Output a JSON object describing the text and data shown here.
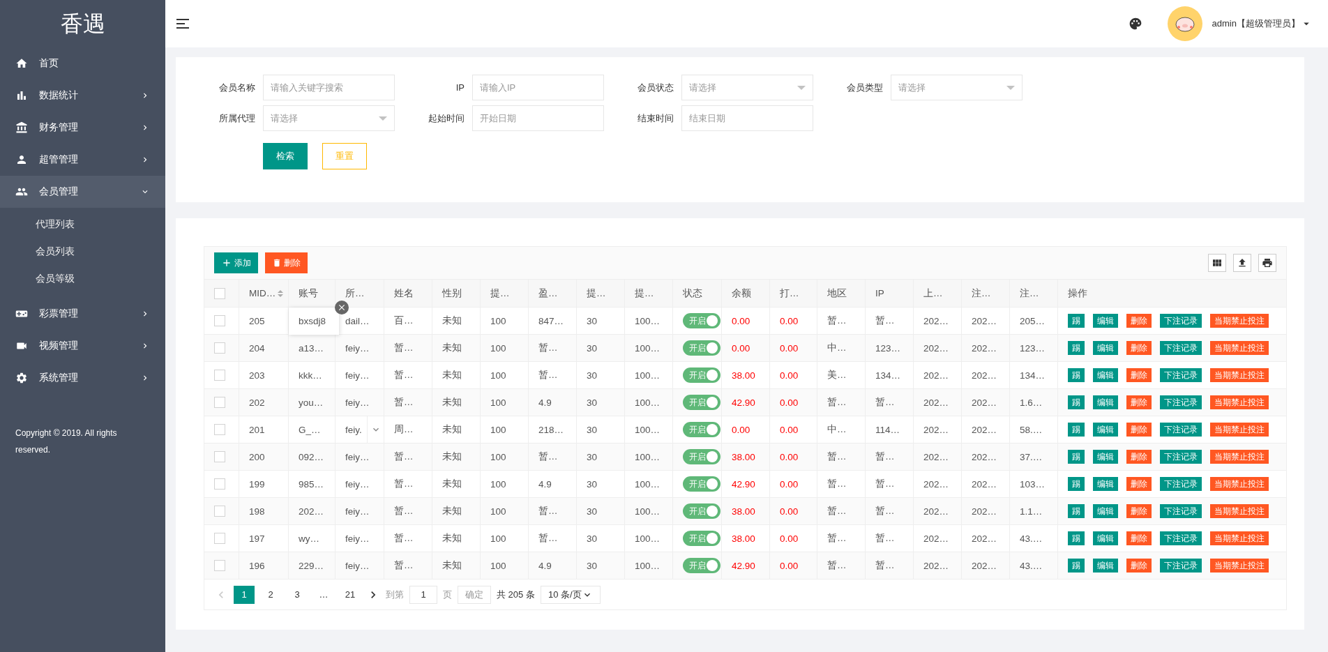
{
  "sidebar": {
    "logo": "香遇",
    "items": [
      {
        "label": "首页",
        "has_arrow": false,
        "expanded": false
      },
      {
        "label": "数据统计",
        "has_arrow": true,
        "expanded": false
      },
      {
        "label": "财务管理",
        "has_arrow": true,
        "expanded": false
      },
      {
        "label": "超管管理",
        "has_arrow": true,
        "expanded": false
      },
      {
        "label": "会员管理",
        "has_arrow": true,
        "expanded": true,
        "children": [
          {
            "label": "代理列表"
          },
          {
            "label": "会员列表"
          },
          {
            "label": "会员等级"
          }
        ]
      },
      {
        "label": "彩票管理",
        "has_arrow": true,
        "expanded": false
      },
      {
        "label": "视频管理",
        "has_arrow": true,
        "expanded": false
      },
      {
        "label": "系统管理",
        "has_arrow": true,
        "expanded": false
      }
    ],
    "copyright": "Copyright © 2019. All rights reserved."
  },
  "header": {
    "user": "admin【超级管理员】"
  },
  "filters": {
    "fields": [
      {
        "label": "会员名称",
        "kind": "input",
        "placeholder": "请输入关键字搜索"
      },
      {
        "label": "IP",
        "kind": "input",
        "placeholder": "请输入IP"
      },
      {
        "label": "会员状态",
        "kind": "select",
        "placeholder": "请选择"
      },
      {
        "label": "会员类型",
        "kind": "select",
        "placeholder": "请选择"
      },
      {
        "label": "所属代理",
        "kind": "select",
        "placeholder": "请选择"
      },
      {
        "label": "起始时间",
        "kind": "input",
        "placeholder": "开始日期"
      },
      {
        "label": "结束时间",
        "kind": "input",
        "placeholder": "结束日期"
      }
    ],
    "buttons": [
      {
        "label": "检索",
        "kind": "primary"
      },
      {
        "label": "重置",
        "kind": "outline"
      }
    ]
  },
  "toolbar": {
    "buttons": [
      {
        "label": "添加",
        "kind": "add"
      },
      {
        "label": "删除",
        "kind": "delete"
      }
    ]
  },
  "table": {
    "all_checked": false,
    "columns": [
      {
        "label": "MID…",
        "kind": "text",
        "sortable": true
      },
      {
        "label": "账号",
        "kind": "text",
        "sortable": false
      },
      {
        "label": "所…",
        "kind": "text",
        "sortable": false
      },
      {
        "label": "姓名",
        "kind": "text",
        "sortable": false
      },
      {
        "label": "性别",
        "kind": "text",
        "sortable": false
      },
      {
        "label": "提…",
        "kind": "text",
        "sortable": false
      },
      {
        "label": "盈…",
        "kind": "text",
        "sortable": false
      },
      {
        "label": "提…",
        "kind": "text",
        "sortable": false
      },
      {
        "label": "提…",
        "kind": "text",
        "sortable": false
      },
      {
        "label": "状态",
        "kind": "switch"
      },
      {
        "label": "余额",
        "kind": "money"
      },
      {
        "label": "打…",
        "kind": "money"
      },
      {
        "label": "地区",
        "kind": "text",
        "sortable": false
      },
      {
        "label": "IP",
        "kind": "text",
        "sortable": false
      },
      {
        "label": "上…",
        "kind": "text",
        "sortable": false
      },
      {
        "label": "注…",
        "kind": "text",
        "sortable": false
      },
      {
        "label": "注…",
        "kind": "text",
        "sortable": false
      },
      {
        "label": "操作",
        "kind": "actions"
      }
    ],
    "rows": [
      {
        "checked": false,
        "expanded": true,
        "dropdown": false,
        "status_on": true,
        "cells": [
          "205",
          "bxsdj8",
          "dail…",
          "百…",
          "未知",
          "100",
          "847…",
          "30",
          "100…",
          "开启",
          "0.00",
          "0.00",
          "暂…",
          "暂…",
          "202…",
          "202…",
          "205…"
        ],
        "actions": [
          {
            "label": "踢",
            "kind": "primary"
          },
          {
            "label": "编辑",
            "kind": "primary"
          },
          {
            "label": "删除",
            "kind": "danger"
          },
          {
            "label": "下注记录",
            "kind": "primary"
          },
          {
            "label": "当期禁止投注",
            "kind": "danger"
          }
        ]
      },
      {
        "checked": false,
        "expanded": false,
        "dropdown": false,
        "status_on": true,
        "cells": [
          "204",
          "a13…",
          "feiy…",
          "暂…",
          "未知",
          "100",
          "暂…",
          "30",
          "100…",
          "开启",
          "0.00",
          "0.00",
          "中…",
          "123…",
          "202…",
          "202…",
          "123…"
        ],
        "actions": [
          {
            "label": "踢",
            "kind": "primary"
          },
          {
            "label": "编辑",
            "kind": "primary"
          },
          {
            "label": "删除",
            "kind": "danger"
          },
          {
            "label": "下注记录",
            "kind": "primary"
          },
          {
            "label": "当期禁止投注",
            "kind": "danger"
          }
        ]
      },
      {
        "checked": false,
        "expanded": false,
        "dropdown": false,
        "status_on": true,
        "cells": [
          "203",
          "kkk…",
          "feiy…",
          "暂…",
          "未知",
          "100",
          "暂…",
          "30",
          "100…",
          "开启",
          "38.00",
          "0.00",
          "美…",
          "134…",
          "202…",
          "202…",
          "134…"
        ],
        "actions": [
          {
            "label": "踢",
            "kind": "primary"
          },
          {
            "label": "编辑",
            "kind": "primary"
          },
          {
            "label": "删除",
            "kind": "danger"
          },
          {
            "label": "下注记录",
            "kind": "primary"
          },
          {
            "label": "当期禁止投注",
            "kind": "danger"
          }
        ]
      },
      {
        "checked": false,
        "expanded": false,
        "dropdown": false,
        "status_on": true,
        "cells": [
          "202",
          "you…",
          "feiy…",
          "暂…",
          "未知",
          "100",
          "4.9",
          "30",
          "100…",
          "开启",
          "42.90",
          "0.00",
          "暂…",
          "暂…",
          "202…",
          "202…",
          "1.6…"
        ],
        "actions": [
          {
            "label": "踢",
            "kind": "primary"
          },
          {
            "label": "编辑",
            "kind": "primary"
          },
          {
            "label": "删除",
            "kind": "danger"
          },
          {
            "label": "下注记录",
            "kind": "primary"
          },
          {
            "label": "当期禁止投注",
            "kind": "danger"
          }
        ]
      },
      {
        "checked": false,
        "expanded": false,
        "dropdown": true,
        "status_on": true,
        "cells": [
          "201",
          "G_…",
          "feiy.",
          "周…",
          "未知",
          "100",
          "218…",
          "30",
          "100…",
          "开启",
          "0.00",
          "0.00",
          "中…",
          "114…",
          "202…",
          "202…",
          "58.…"
        ],
        "actions": [
          {
            "label": "踢",
            "kind": "primary"
          },
          {
            "label": "编辑",
            "kind": "primary"
          },
          {
            "label": "删除",
            "kind": "danger"
          },
          {
            "label": "下注记录",
            "kind": "primary"
          },
          {
            "label": "当期禁止投注",
            "kind": "danger"
          }
        ]
      },
      {
        "checked": false,
        "expanded": false,
        "dropdown": false,
        "status_on": true,
        "cells": [
          "200",
          "092…",
          "feiy…",
          "暂…",
          "未知",
          "100",
          "暂…",
          "30",
          "100…",
          "开启",
          "38.00",
          "0.00",
          "暂…",
          "暂…",
          "202…",
          "202…",
          "37.…"
        ],
        "actions": [
          {
            "label": "踢",
            "kind": "primary"
          },
          {
            "label": "编辑",
            "kind": "primary"
          },
          {
            "label": "删除",
            "kind": "danger"
          },
          {
            "label": "下注记录",
            "kind": "primary"
          },
          {
            "label": "当期禁止投注",
            "kind": "danger"
          }
        ]
      },
      {
        "checked": false,
        "expanded": false,
        "dropdown": false,
        "status_on": true,
        "cells": [
          "199",
          "985…",
          "feiy…",
          "暂…",
          "未知",
          "100",
          "4.9",
          "30",
          "100…",
          "开启",
          "42.90",
          "0.00",
          "暂…",
          "暂…",
          "202…",
          "202…",
          "103…"
        ],
        "actions": [
          {
            "label": "踢",
            "kind": "primary"
          },
          {
            "label": "编辑",
            "kind": "primary"
          },
          {
            "label": "删除",
            "kind": "danger"
          },
          {
            "label": "下注记录",
            "kind": "primary"
          },
          {
            "label": "当期禁止投注",
            "kind": "danger"
          }
        ]
      },
      {
        "checked": false,
        "expanded": false,
        "dropdown": false,
        "status_on": true,
        "cells": [
          "198",
          "202…",
          "feiy…",
          "暂…",
          "未知",
          "100",
          "暂…",
          "30",
          "100…",
          "开启",
          "38.00",
          "0.00",
          "暂…",
          "暂…",
          "202…",
          "202…",
          "1.1…"
        ],
        "actions": [
          {
            "label": "踢",
            "kind": "primary"
          },
          {
            "label": "编辑",
            "kind": "primary"
          },
          {
            "label": "删除",
            "kind": "danger"
          },
          {
            "label": "下注记录",
            "kind": "primary"
          },
          {
            "label": "当期禁止投注",
            "kind": "danger"
          }
        ]
      },
      {
        "checked": false,
        "expanded": false,
        "dropdown": false,
        "status_on": true,
        "cells": [
          "197",
          "wy…",
          "feiy…",
          "暂…",
          "未知",
          "100",
          "暂…",
          "30",
          "100…",
          "开启",
          "38.00",
          "0.00",
          "暂…",
          "暂…",
          "202…",
          "202…",
          "43.…"
        ],
        "actions": [
          {
            "label": "踢",
            "kind": "primary"
          },
          {
            "label": "编辑",
            "kind": "primary"
          },
          {
            "label": "删除",
            "kind": "danger"
          },
          {
            "label": "下注记录",
            "kind": "primary"
          },
          {
            "label": "当期禁止投注",
            "kind": "danger"
          }
        ]
      },
      {
        "checked": false,
        "expanded": false,
        "dropdown": false,
        "status_on": true,
        "cells": [
          "196",
          "229…",
          "feiy…",
          "暂…",
          "未知",
          "100",
          "4.9",
          "30",
          "100…",
          "开启",
          "42.90",
          "0.00",
          "暂…",
          "暂…",
          "202…",
          "202…",
          "43.…"
        ],
        "actions": [
          {
            "label": "踢",
            "kind": "primary"
          },
          {
            "label": "编辑",
            "kind": "primary"
          },
          {
            "label": "删除",
            "kind": "danger"
          },
          {
            "label": "下注记录",
            "kind": "primary"
          },
          {
            "label": "当期禁止投注",
            "kind": "danger"
          }
        ]
      }
    ]
  },
  "pagination": {
    "pages": [
      {
        "label": "1",
        "selected": true
      },
      {
        "label": "2",
        "selected": false
      },
      {
        "label": "3",
        "selected": false
      },
      {
        "label": "…",
        "selected": false
      },
      {
        "label": "21",
        "selected": false
      }
    ],
    "goto_label": "到第",
    "goto_value": "1",
    "page_unit": "页",
    "confirm": "确定",
    "total": "共 205 条",
    "page_size": "10 条/页"
  }
}
